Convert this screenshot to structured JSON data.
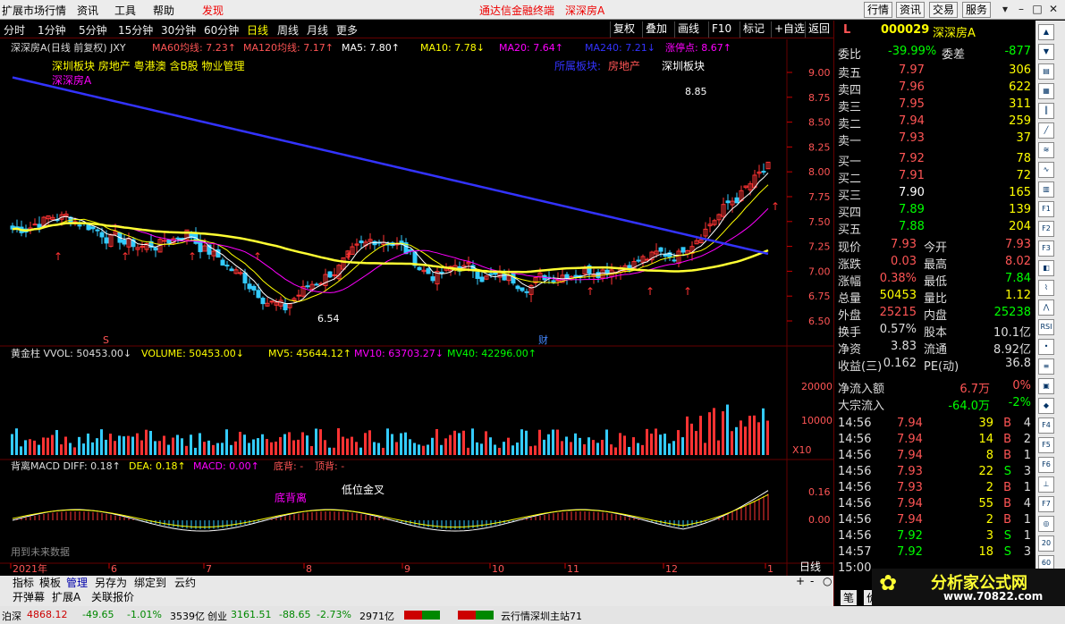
{
  "titlebar": {
    "menus": [
      "扩展市场行情",
      "资讯",
      "工具",
      "帮助",
      "发现"
    ],
    "center": "通达信金融终端",
    "stock": "深深房A",
    "buttons": [
      "行情",
      "资讯",
      "交易",
      "服务"
    ]
  },
  "periods": {
    "items": [
      "分时",
      "1分钟",
      "5分钟",
      "15分钟",
      "30分钟",
      "60分钟",
      "日线",
      "周线",
      "月线",
      "更多"
    ],
    "active": "日线",
    "buttons": [
      "复权",
      "叠加",
      "画线",
      "F10",
      "标记",
      "+自选",
      "返回"
    ]
  },
  "main": {
    "header": [
      {
        "t": "深深房A(日线 前复权) JXY",
        "c": "#ddd"
      },
      {
        "t": "MA60均线: 7.23↑",
        "c": "#f55"
      },
      {
        "t": "MA120均线: 7.17↑",
        "c": "#f55"
      },
      {
        "t": "MA5: 7.80↑",
        "c": "#fff"
      },
      {
        "t": "MA10: 7.78↓",
        "c": "#ff0"
      },
      {
        "t": "MA20: 7.64↑",
        "c": "#f0f"
      },
      {
        "t": "MA240: 7.21↓",
        "c": "#33f"
      },
      {
        "t": "涨停点: 8.67↑",
        "c": "#f0f"
      }
    ],
    "sector_line": "深圳板块 房地产 粤港澳 含B股 物业管理",
    "stock_tag": "深深房A",
    "sector_right": {
      "label": "所属板块:",
      "a": "房地产",
      "b": "深圳板块"
    },
    "peak": "8.85",
    "trough": "6.54",
    "marker_s": "S",
    "marker_cai": "财"
  },
  "volume": {
    "header": [
      {
        "t": "黄金柱 VVOL: 50453.00↓",
        "c": "#ddd"
      },
      {
        "t": "VOLUME: 50453.00↓",
        "c": "#ff0"
      },
      {
        "t": "MV5: 45644.12↑",
        "c": "#ff0"
      },
      {
        "t": "MV10: 63703.27↓",
        "c": "#f0f"
      },
      {
        "t": "MV40: 42296.00↑",
        "c": "#0f0"
      }
    ],
    "ticks": [
      "20000",
      "10000"
    ],
    "unit": "X10"
  },
  "macd": {
    "header": [
      {
        "t": "背离MACD DIFF: 0.18↑",
        "c": "#ddd"
      },
      {
        "t": "DEA: 0.18↑",
        "c": "#ff0"
      },
      {
        "t": "MACD: 0.00↑",
        "c": "#f0f"
      },
      {
        "t": "底背: -",
        "c": "#f55"
      },
      {
        "t": "顶背: -",
        "c": "#f55"
      }
    ],
    "label_div": "底背离",
    "label_cross": "低位金叉",
    "ticks": [
      "0.16",
      "0.00"
    ],
    "future": "用到未来数据"
  },
  "axis": {
    "prices": [
      "9.00",
      "8.75",
      "8.50",
      "8.25",
      "8.00",
      "7.75",
      "7.50",
      "7.25",
      "7.00",
      "6.75",
      "6.50"
    ],
    "months": [
      "2021年",
      "6",
      "7",
      "8",
      "9",
      "10",
      "11",
      "12",
      "1"
    ],
    "period": "日线"
  },
  "quote": {
    "code": "000029",
    "name": "深深房A",
    "weibi": "委比",
    "weibi_v": "-39.99%",
    "weicha": "委差",
    "weicha_v": "-877",
    "asks": [
      {
        "l": "卖五",
        "p": "7.97",
        "v": "306"
      },
      {
        "l": "卖四",
        "p": "7.96",
        "v": "622"
      },
      {
        "l": "卖三",
        "p": "7.95",
        "v": "311"
      },
      {
        "l": "卖二",
        "p": "7.94",
        "v": "259"
      },
      {
        "l": "卖一",
        "p": "7.93",
        "v": "37"
      }
    ],
    "bids": [
      {
        "l": "买一",
        "p": "7.92",
        "v": "78"
      },
      {
        "l": "买二",
        "p": "7.91",
        "v": "72"
      },
      {
        "l": "买三",
        "p": "7.90",
        "v": "165"
      },
      {
        "l": "买四",
        "p": "7.89",
        "v": "139"
      },
      {
        "l": "买五",
        "p": "7.88",
        "v": "204"
      }
    ],
    "stats": [
      {
        "a": "现价",
        "av": "7.93",
        "ac": "#f55",
        "b": "今开",
        "bv": "7.93",
        "bc": "#f55"
      },
      {
        "a": "涨跌",
        "av": "0.03",
        "ac": "#f55",
        "b": "最高",
        "bv": "8.02",
        "bc": "#f55"
      },
      {
        "a": "涨幅",
        "av": "0.38%",
        "ac": "#f55",
        "b": "最低",
        "bv": "7.84",
        "bc": "#0f0"
      },
      {
        "a": "总量",
        "av": "50453",
        "ac": "#ff0",
        "b": "量比",
        "bv": "1.12",
        "bc": "#ff0"
      },
      {
        "a": "外盘",
        "av": "25215",
        "ac": "#f55",
        "b": "内盘",
        "bv": "25238",
        "bc": "#0f0"
      },
      {
        "a": "换手",
        "av": "0.57%",
        "ac": "#ddd",
        "b": "股本",
        "bv": "10.1亿",
        "bc": "#ddd"
      },
      {
        "a": "净资",
        "av": "3.83",
        "ac": "#ddd",
        "b": "流通",
        "bv": "8.92亿",
        "bc": "#ddd"
      },
      {
        "a": "收益(三)",
        "av": "0.162",
        "ac": "#ddd",
        "b": "PE(动)",
        "bv": "36.8",
        "bc": "#ddd"
      }
    ],
    "flow": [
      {
        "l": "净流入额",
        "v": "6.7万",
        "p": "0%"
      },
      {
        "l": "大宗流入",
        "v": "-64.0万",
        "p": "-2%"
      }
    ],
    "ticks": [
      {
        "t": "14:56",
        "p": "7.94",
        "v": "39",
        "s": "B",
        "n": "4"
      },
      {
        "t": "14:56",
        "p": "7.94",
        "v": "14",
        "s": "B",
        "n": "2"
      },
      {
        "t": "14:56",
        "p": "7.94",
        "v": "8",
        "s": "B",
        "n": "1"
      },
      {
        "t": "14:56",
        "p": "7.93",
        "v": "22",
        "s": "S",
        "n": "3"
      },
      {
        "t": "14:56",
        "p": "7.93",
        "v": "2",
        "s": "B",
        "n": "1"
      },
      {
        "t": "14:56",
        "p": "7.94",
        "v": "55",
        "s": "B",
        "n": "4"
      },
      {
        "t": "14:56",
        "p": "7.94",
        "v": "2",
        "s": "B",
        "n": "1"
      },
      {
        "t": "14:56",
        "p": "7.92",
        "v": "3",
        "s": "S",
        "n": "1"
      },
      {
        "t": "14:57",
        "p": "7.92",
        "v": "18",
        "s": "S",
        "n": "3"
      },
      {
        "t": "15:00",
        "p": "",
        "v": "",
        "s": "",
        "n": ""
      }
    ]
  },
  "bottom": {
    "row1": [
      "指标",
      "模板",
      "管理",
      "另存为",
      "绑定到",
      "云约"
    ],
    "row2": [
      "开弹幕",
      "扩展A",
      "关联报价"
    ],
    "tabs": [
      "笔",
      "价"
    ]
  },
  "status": {
    "a": "泊深",
    "a1": "4868.12",
    "a2": "-49.65",
    "a3": "-1.01%",
    "a4": "3539亿",
    "b": "创业",
    "b1": "3161.51",
    "b2": "-88.65",
    "b3": "-2.73%",
    "b4": "2971亿",
    "c": "云行情深圳主站71"
  },
  "logo": {
    "text": "分析家公式网",
    "url": "www.70822.com"
  }
}
